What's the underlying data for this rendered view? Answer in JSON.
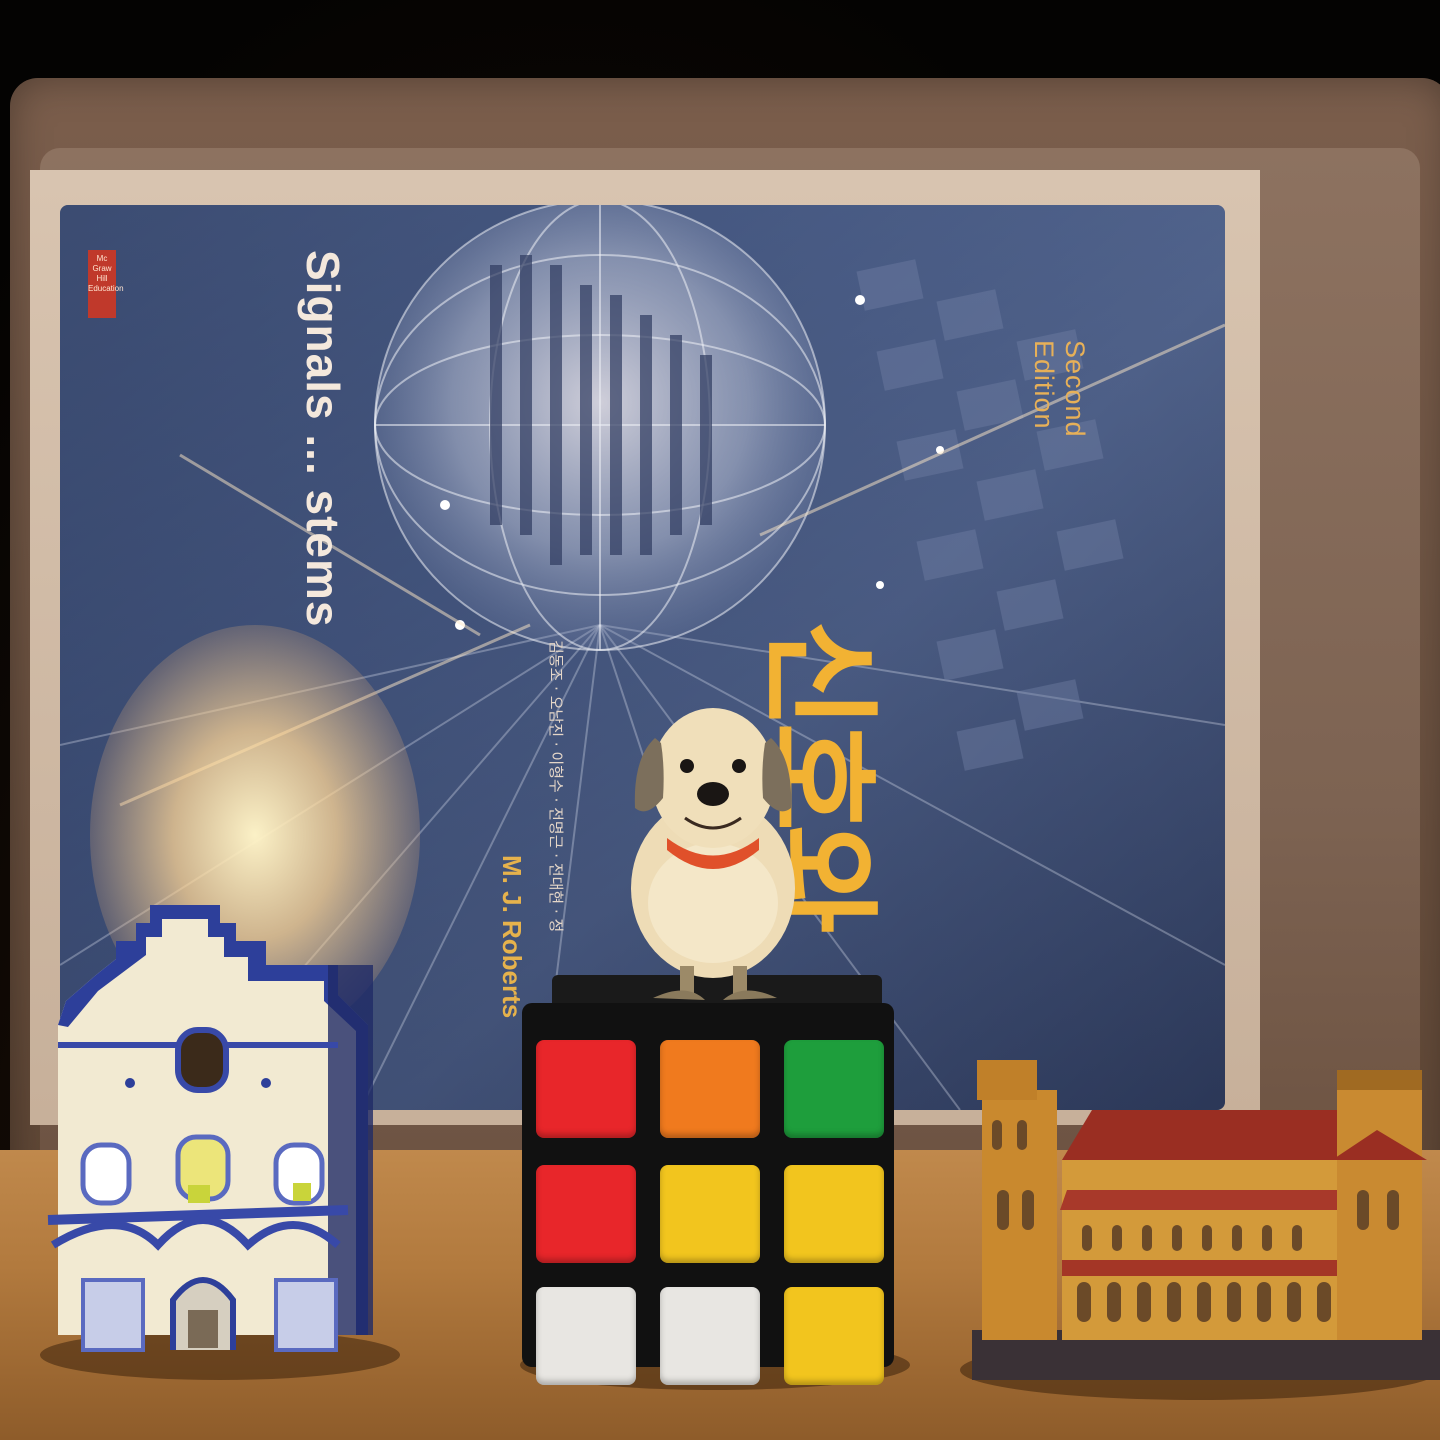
{
  "book": {
    "publisher_logo": "Mc Graw Hill Education",
    "edition": "Second Edition",
    "title_en": "Signals ... stems",
    "title_ko": "신호와",
    "author": "M. J. Roberts",
    "translators": "김동조 · 오남진 · 이형수 · 전명근 · 전대현 · 정"
  },
  "colors": {
    "shelf": "#b27a3e",
    "cover": "#3d4f78",
    "title_gold": "#f2b233",
    "cube_red": "#e8262a",
    "cube_orange": "#f07a1e",
    "cube_green": "#1e9e3c",
    "cube_yellow": "#f2c51e",
    "cube_white": "#e8e6e2",
    "dog_collar": "#e0502a"
  },
  "objects": {
    "house": "delft-ceramic-house",
    "cube": "rubiks-cube",
    "dog": "dog-figurine",
    "cathedral": "cathedral-miniature"
  }
}
